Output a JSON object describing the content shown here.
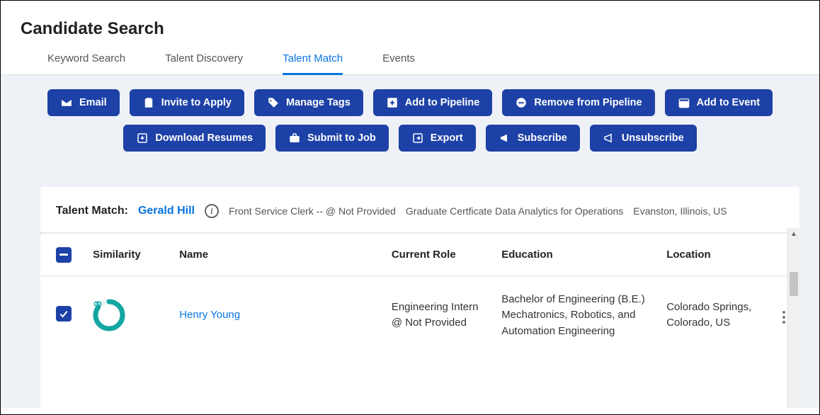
{
  "page_title": "Candidate Search",
  "tabs": [
    {
      "label": "Keyword Search",
      "active": false
    },
    {
      "label": "Talent Discovery",
      "active": false
    },
    {
      "label": "Talent Match",
      "active": true
    },
    {
      "label": "Events",
      "active": false
    }
  ],
  "actions": {
    "email": "Email",
    "invite": "Invite to Apply",
    "tags": "Manage Tags",
    "add_pipeline": "Add to Pipeline",
    "remove_pipeline": "Remove from Pipeline",
    "add_event": "Add to Event",
    "download": "Download Resumes",
    "submit": "Submit to Job",
    "export": "Export",
    "subscribe": "Subscribe",
    "unsubscribe": "Unsubscribe"
  },
  "match": {
    "label": "Talent Match:",
    "name": "Gerald Hill",
    "role": "Front Service Clerk -- @ Not Provided",
    "education": "Graduate Certficate Data Analytics for Operations",
    "location": "Evanston, Illinois, US"
  },
  "table": {
    "headers": {
      "similarity": "Similarity",
      "name": "Name",
      "role": "Current Role",
      "education": "Education",
      "location": "Location"
    },
    "rows": [
      {
        "name": "Henry Young",
        "role": "Engineering Intern @ Not Provided",
        "education": "Bachelor of Engineering (B.E.) Mechatronics, Robotics, and Automation Engineering",
        "location": "Colorado Springs, Colorado, US"
      }
    ]
  }
}
